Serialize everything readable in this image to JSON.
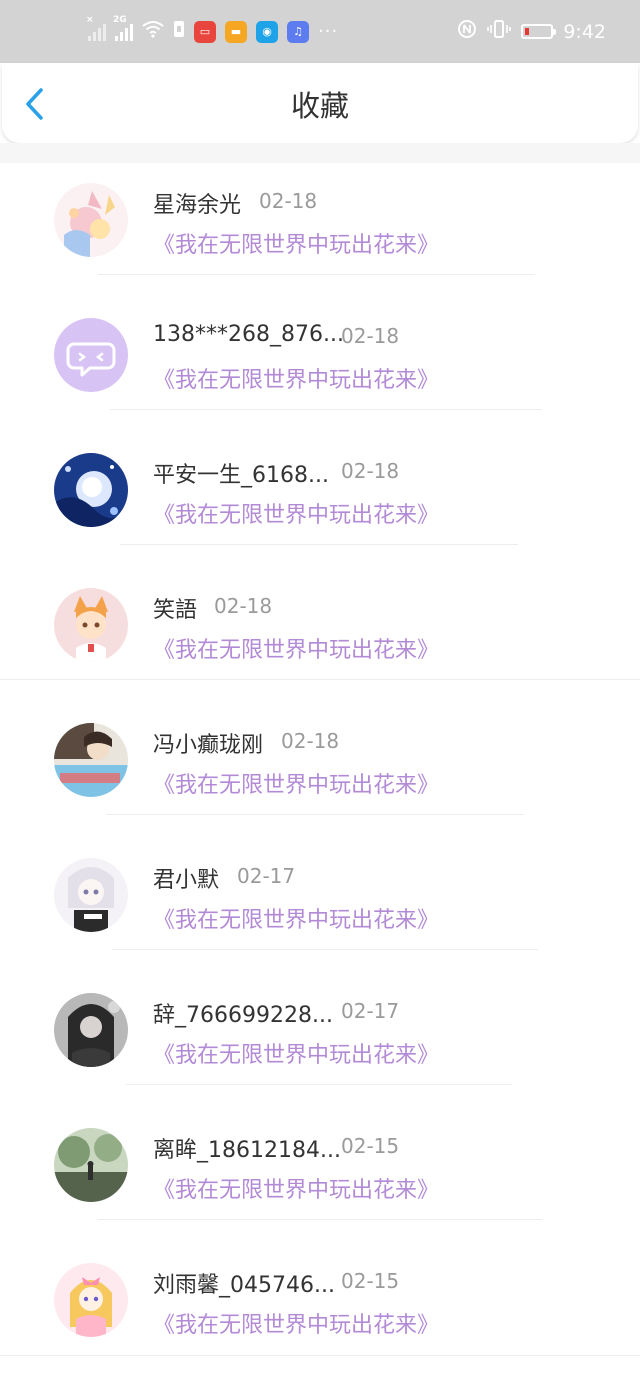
{
  "status_bar": {
    "time": "9:42",
    "signal1_tag": "×",
    "signal2_tag": "2G"
  },
  "header": {
    "title": "收藏"
  },
  "items": [
    {
      "name": "星海余光",
      "date": "02-18",
      "book": "《我在无限世界中玩出花来》"
    },
    {
      "name": "138***268_876...",
      "date": "02-18",
      "book": "《我在无限世界中玩出花来》"
    },
    {
      "name": "平安一生_6168...",
      "date": "02-18",
      "book": "《我在无限世界中玩出花来》"
    },
    {
      "name": "笑語",
      "date": "02-18",
      "book": "《我在无限世界中玩出花来》"
    },
    {
      "name": "冯小癫珑刚",
      "date": "02-18",
      "book": "《我在无限世界中玩出花来》"
    },
    {
      "name": "君小默",
      "date": "02-17",
      "book": "《我在无限世界中玩出花来》"
    },
    {
      "name": "辞_766699228...",
      "date": "02-17",
      "book": "《我在无限世界中玩出花来》"
    },
    {
      "name": "离眸_18612184...",
      "date": "02-15",
      "book": "《我在无限世界中玩出花来》"
    },
    {
      "name": "刘雨馨_045746...",
      "date": "02-15",
      "book": "《我在无限世界中玩出花来》"
    }
  ],
  "colors": {
    "accent": "#2aa0e8",
    "book_title": "#b38ad6",
    "date": "#9a9a9a",
    "status_bar": "#d3d3d3",
    "default_avatar": "#d7c4f4"
  }
}
